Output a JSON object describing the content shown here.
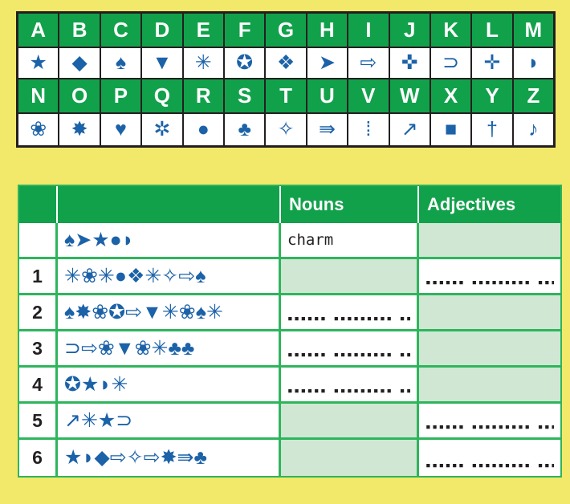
{
  "colors": {
    "page_background": "#f2e86a",
    "green_header": "#12a14b",
    "green_border": "#2eb55c",
    "shaded_cell": "#cfe7d3",
    "symbol_blue": "#1b62a8",
    "key_border": "#231f20"
  },
  "cipher_key": {
    "row1": {
      "letters": [
        "A",
        "B",
        "C",
        "D",
        "E",
        "F",
        "G",
        "H",
        "I",
        "J",
        "K",
        "L",
        "M"
      ],
      "symbols": [
        "★",
        "◆",
        "♠",
        "▼",
        "✳",
        "✪",
        "❖",
        "➤",
        "⇨",
        "✜",
        "⊃",
        "✛",
        "◗"
      ],
      "symbol_names": [
        "filled-five-point-star",
        "filled-diamond",
        "spade",
        "filled-down-triangle",
        "eight-spoke-asterisk",
        "star-in-circle",
        "four-diamond-cluster",
        "filled-arrowhead-right",
        "outlined-right-arrow",
        "filled-cross-plump",
        "open-crescent-loop",
        "small-plus-arrows",
        "half-moon-right"
      ]
    },
    "row2": {
      "letters": [
        "N",
        "O",
        "P",
        "Q",
        "R",
        "S",
        "T",
        "U",
        "V",
        "W",
        "X",
        "Y",
        "Z"
      ],
      "symbols": [
        "❀",
        "✸",
        "♥",
        "✲",
        "●",
        "♣",
        "✧",
        "⇛",
        "⁞",
        "↗",
        "■",
        "†",
        "♪"
      ],
      "symbol_names": [
        "five-petal-flower",
        "eight-point-burst",
        "heart",
        "six-spoke-snowflake",
        "filled-circle",
        "club",
        "outlined-four-point-star",
        "double-right-arrow",
        "two-dots-vertical",
        "arrow-with-tail-up-right",
        "filled-square",
        "dagger-cross",
        "music-note-glyph"
      ]
    }
  },
  "table": {
    "headers": {
      "number": "",
      "symbols": "",
      "nouns": "Nouns",
      "adjectives": "Adjectives"
    },
    "rows": [
      {
        "number": "",
        "symbols": "♠➤★●◗",
        "symbol_names": [
          "spade",
          "filled-arrowhead-right",
          "filled-five-point-star",
          "filled-circle",
          "half-moon-right"
        ],
        "noun": "charm",
        "noun_shaded": false,
        "adjective": "",
        "adjective_shaded": true,
        "noun_dots": false,
        "adjective_dots": false
      },
      {
        "number": "1",
        "symbols": "✳❀✳●❖✳✧⇨♠",
        "symbol_names": [
          "eight-spoke-asterisk",
          "five-petal-flower",
          "eight-spoke-asterisk",
          "filled-circle",
          "four-diamond-cluster",
          "eight-spoke-asterisk",
          "outlined-four-point-star",
          "outlined-right-arrow",
          "spade"
        ],
        "noun": "",
        "noun_shaded": true,
        "adjective": "",
        "adjective_shaded": false,
        "noun_dots": false,
        "adjective_dots": true
      },
      {
        "number": "2",
        "symbols": "♠✸❀✪⇨▼✳❀♠✳",
        "symbol_names": [
          "spade",
          "eight-point-burst",
          "five-petal-flower",
          "star-in-circle",
          "outlined-right-arrow",
          "filled-down-triangle",
          "eight-spoke-asterisk",
          "five-petal-flower",
          "spade",
          "eight-spoke-asterisk"
        ],
        "noun": "",
        "noun_shaded": false,
        "adjective": "",
        "adjective_shaded": true,
        "noun_dots": true,
        "adjective_dots": false
      },
      {
        "number": "3",
        "symbols": "⊃⇨❀▼❀✳♣♣",
        "symbol_names": [
          "open-crescent-loop",
          "outlined-right-arrow",
          "five-petal-flower",
          "filled-down-triangle",
          "five-petal-flower",
          "eight-spoke-asterisk",
          "club",
          "club"
        ],
        "noun": "",
        "noun_shaded": false,
        "adjective": "",
        "adjective_shaded": true,
        "noun_dots": true,
        "adjective_dots": false
      },
      {
        "number": "4",
        "symbols": "✪★◗✳",
        "symbol_names": [
          "star-in-circle",
          "filled-five-point-star",
          "half-moon-right",
          "eight-spoke-asterisk"
        ],
        "noun": "",
        "noun_shaded": false,
        "adjective": "",
        "adjective_shaded": true,
        "noun_dots": true,
        "adjective_dots": false
      },
      {
        "number": "5",
        "symbols": "↗✳★⊃",
        "symbol_names": [
          "arrow-with-tail-up-right",
          "eight-spoke-asterisk",
          "filled-five-point-star",
          "open-crescent-loop"
        ],
        "noun": "",
        "noun_shaded": true,
        "adjective": "",
        "adjective_shaded": false,
        "noun_dots": false,
        "adjective_dots": true
      },
      {
        "number": "6",
        "symbols": "★◗◆⇨✧⇨✸⇛♣",
        "symbol_names": [
          "filled-five-point-star",
          "half-moon-right",
          "filled-diamond",
          "outlined-right-arrow",
          "outlined-four-point-star",
          "outlined-right-arrow",
          "eight-point-burst",
          "double-right-arrow",
          "club"
        ],
        "noun": "",
        "noun_shaded": true,
        "adjective": "",
        "adjective_shaded": false,
        "noun_dots": false,
        "adjective_dots": true
      }
    ],
    "dot_line": "▪▪▪▪▪▪ ▪▪▪▪▪▪▪▪▪ ▪▪▪▪▪▪▪▪▪▪ ▪▪▪▪▪▪"
  }
}
